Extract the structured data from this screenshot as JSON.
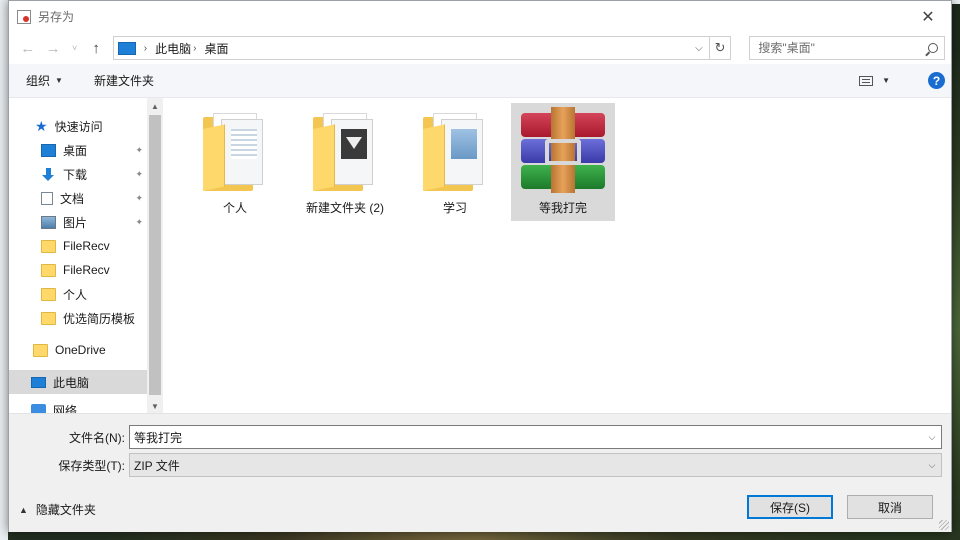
{
  "window": {
    "title": "另存为",
    "close_glyph": "✕"
  },
  "address": {
    "back_glyph": "←",
    "forward_glyph": "→",
    "recent_glyph": "˅",
    "up_glyph": "↑",
    "crumbs": [
      "此电脑",
      "桌面"
    ],
    "crumb_sep": "›",
    "dropdown_glyph": "⌵",
    "refresh_glyph": "↻"
  },
  "search": {
    "placeholder": "搜索\"桌面\"",
    "icon": "search-icon"
  },
  "toolbar": {
    "organize_label": "组织",
    "new_folder_label": "新建文件夹",
    "help_label": "?"
  },
  "nav": {
    "items": [
      {
        "label": "快速访问",
        "icon": "star-icon"
      },
      {
        "label": "桌面",
        "icon": "desktop-icon",
        "pinned": true
      },
      {
        "label": "下载",
        "icon": "download-icon",
        "pinned": true
      },
      {
        "label": "文档",
        "icon": "document-icon",
        "pinned": true
      },
      {
        "label": "图片",
        "icon": "pictures-icon",
        "pinned": true
      },
      {
        "label": "FileRecv",
        "icon": "folder-icon"
      },
      {
        "label": "FileRecv",
        "icon": "folder-icon"
      },
      {
        "label": "个人",
        "icon": "folder-icon"
      },
      {
        "label": "优选简历模板",
        "icon": "folder-icon"
      },
      {
        "label": "OneDrive",
        "icon": "folder-icon"
      },
      {
        "label": "此电脑",
        "icon": "computer-icon",
        "selected": true
      },
      {
        "label": "网络",
        "icon": "network-icon"
      }
    ],
    "pin_glyph": "📌"
  },
  "files": [
    {
      "label": "个人",
      "type": "folder"
    },
    {
      "label": "新建文件夹 (2)",
      "type": "folder"
    },
    {
      "label": "学习",
      "type": "folder"
    },
    {
      "label": "等我打完",
      "type": "archive",
      "selected": true
    }
  ],
  "form": {
    "filename_label": "文件名(N):",
    "filename_value": "等我打完",
    "filetype_label": "保存类型(T):",
    "filetype_value": "ZIP 文件",
    "hide_folders_label": "隐藏文件夹",
    "save_label": "保存(S)",
    "cancel_label": "取消"
  },
  "colors": {
    "accent": "#0078d7",
    "selection": "#d9d9d9",
    "folder": "#ffd86b"
  }
}
